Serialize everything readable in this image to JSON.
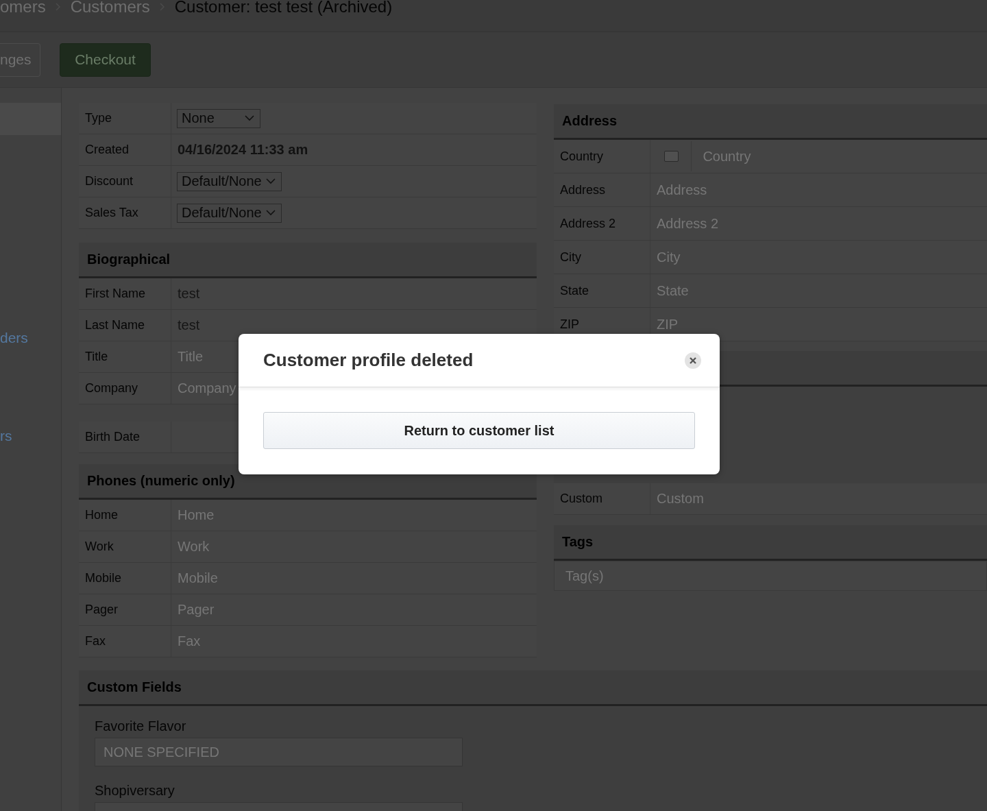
{
  "breadcrumbs": [
    {
      "label": "omers",
      "current": false
    },
    {
      "label": "Customers",
      "current": false
    },
    {
      "label": "Customer:  test test (Archived)",
      "current": true
    }
  ],
  "toolbar": {
    "buttons": [
      {
        "label": "nges",
        "kind": "secondary"
      },
      {
        "label": "Checkout",
        "kind": "primary"
      }
    ]
  },
  "sidebar": {
    "links": [
      "ders",
      "rs"
    ]
  },
  "general": {
    "rows": [
      {
        "label": "Type",
        "kind": "select",
        "value": "None"
      },
      {
        "label": "Created",
        "kind": "text",
        "value": "04/16/2024 11:33 am"
      },
      {
        "label": "Discount",
        "kind": "select",
        "value": "Default/None"
      },
      {
        "label": "Sales Tax",
        "kind": "select",
        "value": "Default/None"
      }
    ]
  },
  "biographical": {
    "title": "Biographical",
    "rows": [
      {
        "label": "First Name",
        "kind": "input",
        "value": "test"
      },
      {
        "label": "Last Name",
        "kind": "input",
        "value": "test"
      },
      {
        "label": "Title",
        "kind": "input",
        "placeholder": "Title"
      },
      {
        "label": "Company",
        "kind": "input",
        "placeholder": "Company"
      }
    ],
    "birth_date": {
      "label": "Birth Date"
    }
  },
  "phones": {
    "title": "Phones (numeric only)",
    "rows": [
      {
        "label": "Home",
        "kind": "input",
        "placeholder": "Home"
      },
      {
        "label": "Work",
        "kind": "input",
        "placeholder": "Work"
      },
      {
        "label": "Mobile",
        "kind": "input",
        "placeholder": "Mobile"
      },
      {
        "label": "Pager",
        "kind": "input",
        "placeholder": "Pager"
      },
      {
        "label": "Fax",
        "kind": "input",
        "placeholder": "Fax"
      }
    ]
  },
  "address": {
    "title": "Address",
    "rows": [
      {
        "label": "Country",
        "kind": "country",
        "placeholder": "Country"
      },
      {
        "label": "Address",
        "kind": "input",
        "placeholder": "Address"
      },
      {
        "label": "Address 2",
        "kind": "input",
        "placeholder": "Address 2"
      },
      {
        "label": "City",
        "kind": "input",
        "placeholder": "City"
      },
      {
        "label": "State",
        "kind": "input",
        "placeholder": "State"
      },
      {
        "label": "ZIP",
        "kind": "input",
        "placeholder": "ZIP"
      }
    ]
  },
  "covered_section": {
    "rows": [
      {
        "label": "Custom",
        "kind": "input",
        "placeholder": "Custom"
      }
    ]
  },
  "tags": {
    "title": "Tags",
    "placeholder": "Tag(s)"
  },
  "custom_fields": {
    "title": "Custom Fields",
    "fields": [
      {
        "label": "Favorite Flavor",
        "placeholder": "NONE SPECIFIED"
      },
      {
        "label": "Shopiversary"
      }
    ]
  },
  "modal": {
    "title": "Customer profile deleted",
    "button": "Return to customer list"
  }
}
